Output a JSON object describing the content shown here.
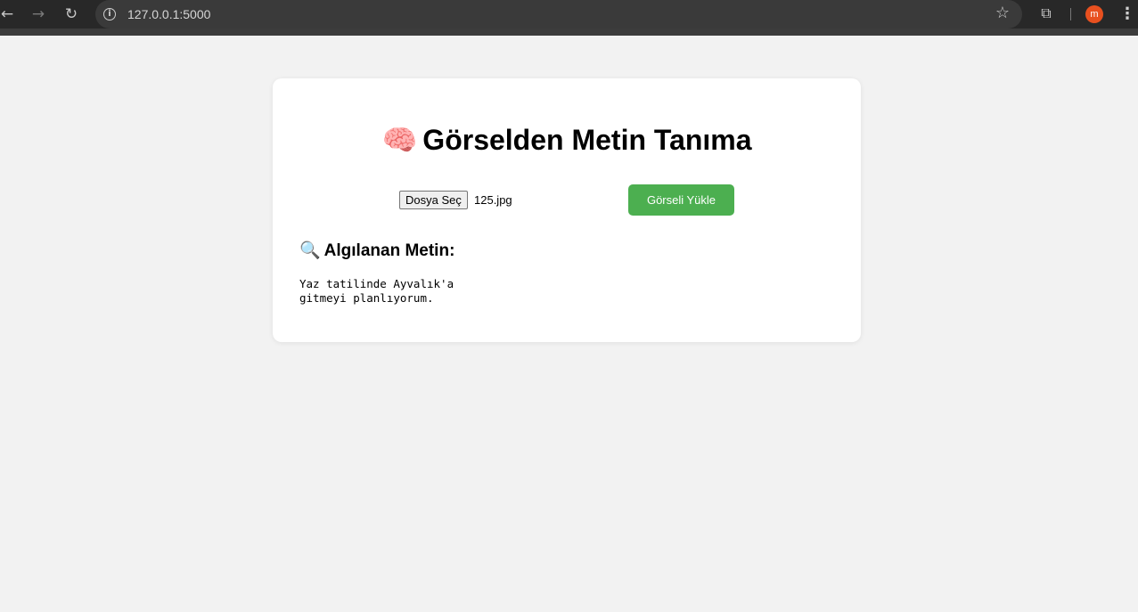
{
  "browser": {
    "url": "127.0.0.1:5000",
    "back_icon": "←",
    "forward_icon": "→",
    "reload_icon": "↻",
    "info_icon": "i",
    "star_icon": "☆",
    "extensions_icon": "⧉",
    "profile_initial": "m",
    "menu_icon": "⋮",
    "profile_color": "#e8501f"
  },
  "page": {
    "title_emoji": "🧠",
    "title": "Görselden Metin Tanıma",
    "file_button_label": "Dosya Seç",
    "file_name": "125.jpg",
    "upload_button_label": "Görseli Yükle",
    "upload_button_color": "#4caf50",
    "result_emoji": "🔍",
    "result_heading": "Algılanan Metin:",
    "result_text": "Yaz tatilinde Ayvalık'a\ngitmeyi planlıyorum."
  }
}
